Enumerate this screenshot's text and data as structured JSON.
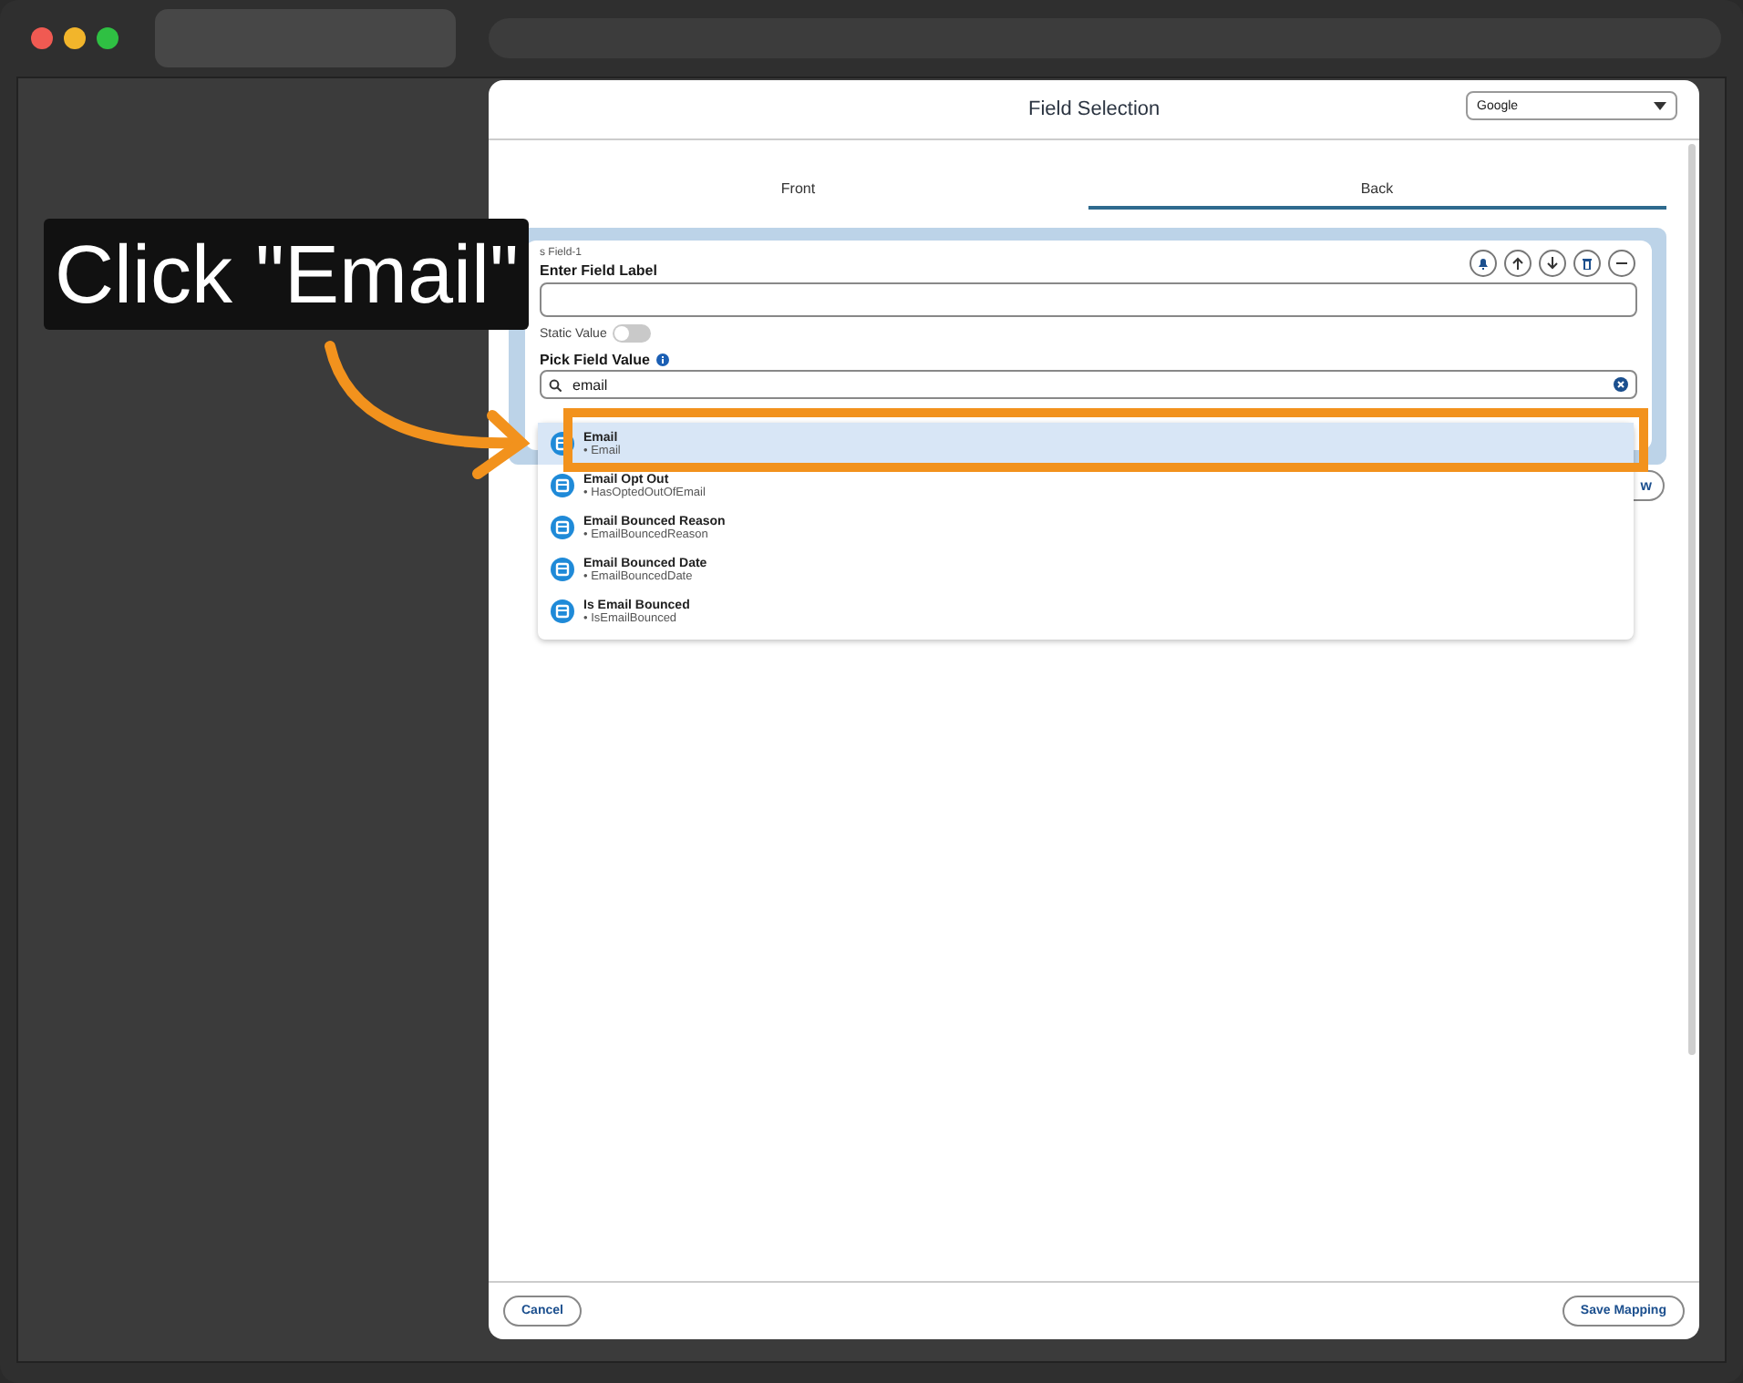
{
  "modal": {
    "title": "Field Selection",
    "source_select": {
      "value": "Google"
    },
    "tabs": [
      {
        "label": "Front",
        "selected": false
      },
      {
        "label": "Back",
        "selected": true
      }
    ],
    "field_card": {
      "caption": "s Field-1",
      "label_heading": "Enter Field Label",
      "static_value": {
        "label": "Static Value",
        "on": false
      },
      "pick_heading": "Pick Field Value",
      "search": {
        "value": "email"
      },
      "options": [
        {
          "label": "Email",
          "api_name": "• Email",
          "selected": true
        },
        {
          "label": "Email Opt Out",
          "api_name": "• HasOptedOutOfEmail",
          "selected": false
        },
        {
          "label": "Email Bounced Reason",
          "api_name": "• EmailBouncedReason",
          "selected": false
        },
        {
          "label": "Email Bounced Date",
          "api_name": "• EmailBouncedDate",
          "selected": false
        },
        {
          "label": "Is Email Bounced",
          "api_name": "• IsEmailBounced",
          "selected": false
        }
      ]
    },
    "peek_button": "w",
    "footer": {
      "buttons": [
        "Cancel",
        "Save Mapping"
      ]
    }
  },
  "callout": {
    "text": "Click \"Email\""
  }
}
